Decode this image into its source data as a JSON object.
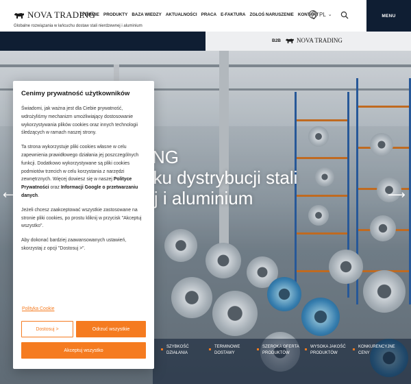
{
  "brand": {
    "name": "NOVA TRADING",
    "tagline": "Globalne rozwiązania w łańcuchu dostaw stali nierdzewnej i aluminium"
  },
  "nav": [
    "O FIRMIE",
    "PRODUKTY",
    "BAZA WIEDZY",
    "AKTUALNOŚCI",
    "PRACA",
    "E-FAKTURA",
    "ZGŁOŚ NARUSZENIE",
    "KONTAKT"
  ],
  "lang": {
    "code": "PL"
  },
  "menu_label": "MENU",
  "strip": {
    "b2b": "B2B",
    "logo_text": "NOVA TRADING"
  },
  "hero": {
    "line1": "DING",
    "line2": "ynku dystrybucji stali",
    "line3": "nej i aluminium"
  },
  "features": [
    "SZYBKOŚĆ DZIAŁANIA",
    "TERMINOWE DOSTAWY",
    "SZEROKA OFERTA PRODUKTÓW",
    "WYSOKA JAKOŚĆ PRODUKTÓW",
    "KONKURENCYJNE CENY"
  ],
  "cookie": {
    "title": "Cenimy prywatność użytkowników",
    "p1": "Świadomi, jak ważna jest dla Ciebie prywatność, wdrożyliśmy mechanizm umożliwiający dostosowanie wykorzystywania plików cookies oraz innych technologii śledzących w ramach naszej strony.",
    "p2_a": "Ta strona wykorzystuje pliki cookies własne w celu zapewnienia prawidłowego działania jej poszczególnych funkcji. Dodatkowo wykorzystywane są pliki cookies podmiotów trzecich w celu korzystania z narzędzi zewnętrznych. Więcej dowiesz się w naszej ",
    "p2_link1": "Polityce Prywatności",
    "p2_mid": " oraz ",
    "p2_link2": "Informacji Google o przetwarzaniu danych",
    "p2_end": ".",
    "p3": "Jeżeli chcesz zaakceptować wszystkie zastosowane na stronie pliki cookies, po prostu kliknij w przycisk \"Akceptuj wszystko\".",
    "p4": "Aby dokonać bardziej zaawansowanych ustawień, skorzystaj z opcji \"Dostosuj >\".",
    "policy_link": "Polityka Cookie",
    "btn_customize": "Dostosuj >",
    "btn_reject": "Odrzuć wszystkie",
    "btn_accept": "Akceptuj wszystko"
  },
  "colors": {
    "accent": "#f57b20",
    "navy": "#0f1e33"
  }
}
